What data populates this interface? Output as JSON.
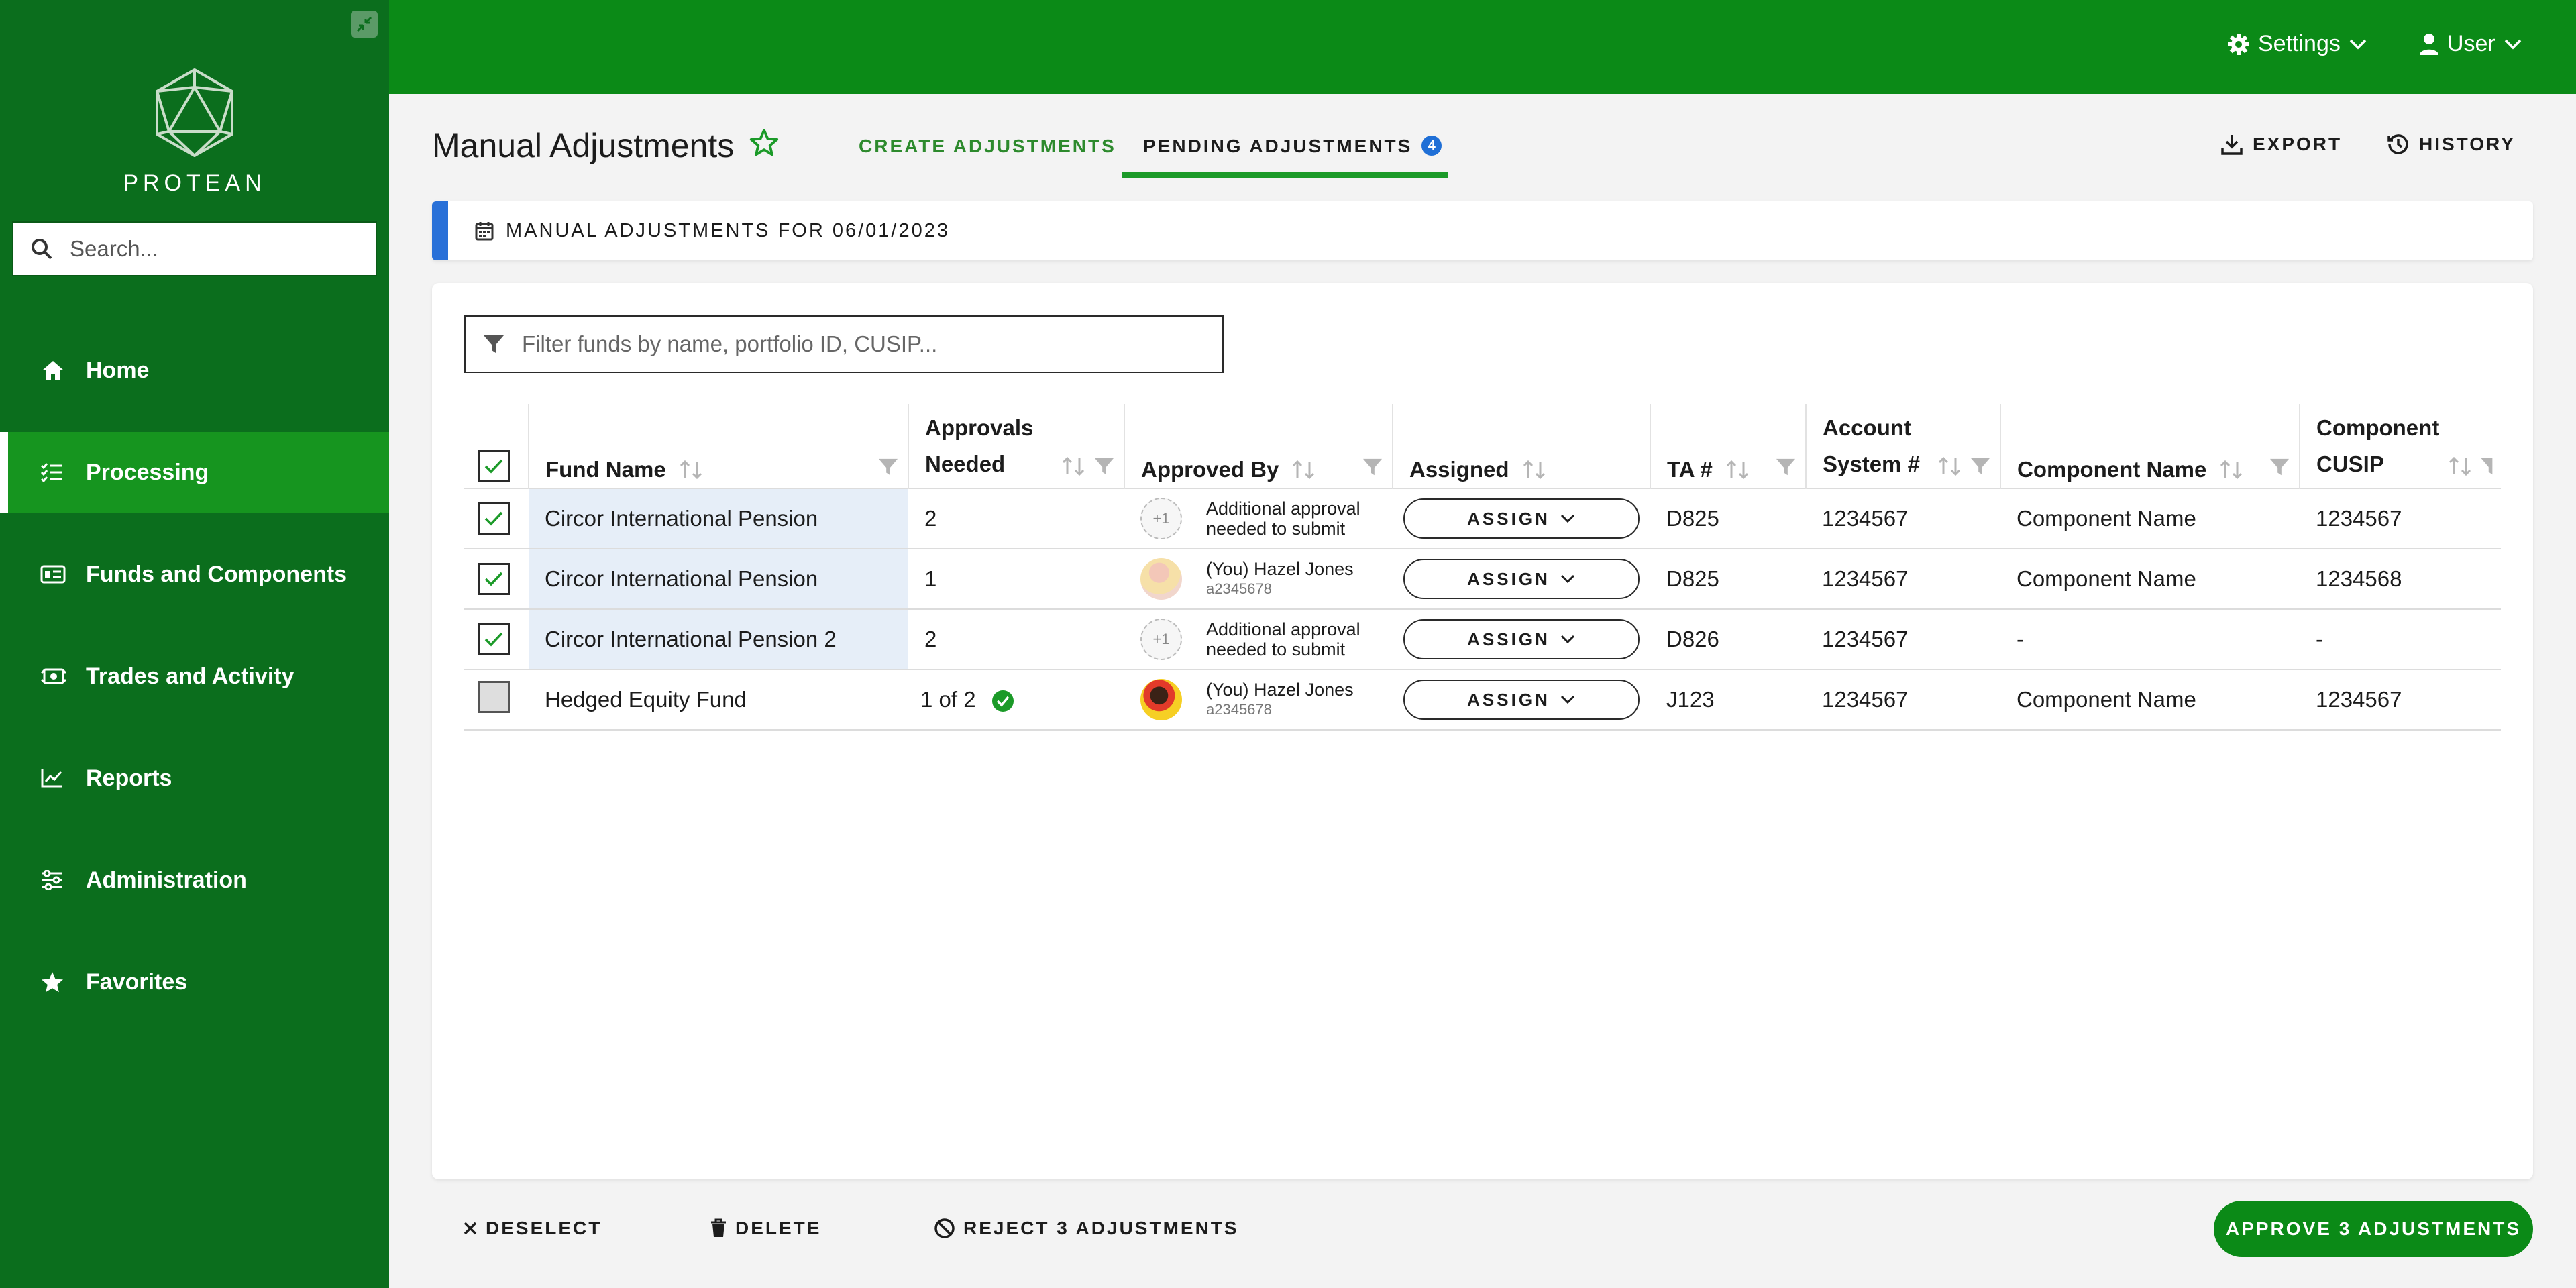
{
  "app": {
    "logo_text": "PROTEAN",
    "search_placeholder": "Search..."
  },
  "sidebar": {
    "items": [
      {
        "label": "Home",
        "icon": "home-icon"
      },
      {
        "label": "Processing",
        "icon": "checklist-icon",
        "active": true
      },
      {
        "label": "Funds and Components",
        "icon": "id-card-icon"
      },
      {
        "label": "Trades and Activity",
        "icon": "money-exchange-icon"
      },
      {
        "label": "Reports",
        "icon": "line-chart-icon"
      },
      {
        "label": "Administration",
        "icon": "sliders-icon"
      },
      {
        "label": "Favorites",
        "icon": "star-icon"
      }
    ]
  },
  "topbar": {
    "settings_label": "Settings",
    "user_label": "User"
  },
  "header": {
    "title": "Manual Adjustments",
    "tabs": [
      {
        "label": "CREATE ADJUSTMENTS"
      },
      {
        "label": "PENDING ADJUSTMENTS",
        "badge": "4",
        "active": true
      }
    ],
    "export_label": "EXPORT",
    "history_label": "HISTORY"
  },
  "banner": {
    "text": "MANUAL ADJUSTMENTS FOR 06/01/2023"
  },
  "table": {
    "filter_placeholder": "Filter funds by name, portfolio ID, CUSIP...",
    "columns": {
      "fund_name": "Fund Name",
      "approvals_line1": "Approvals",
      "approvals_line2": "Needed",
      "approved_by": "Approved By",
      "assigned": "Assigned",
      "ta": "TA #",
      "account_line1": "Account",
      "account_line2": "System  #",
      "component_name": "Component Name",
      "cusip_line1": "Component",
      "cusip_line2": "CUSIP"
    },
    "assign_label": "ASSIGN",
    "rows": [
      {
        "fund": "Circor International Pension",
        "approvals": "2",
        "approver_main": "Additional approval",
        "approver_sub": "needed to submit",
        "avatar_text": "+1",
        "ta": "D825",
        "account": "1234567",
        "component": "Component Name",
        "cusip": "1234567"
      },
      {
        "fund": "Circor International Pension",
        "approvals": "1",
        "approver_main": "(You) Hazel Jones",
        "approver_sub": "a2345678",
        "ta": "D825",
        "account": "1234567",
        "component": "Component Name",
        "cusip": "1234568"
      },
      {
        "fund": "Circor International Pension 2",
        "approvals": "2",
        "approver_main": "Additional approval",
        "approver_sub": "needed to submit",
        "avatar_text": "+1",
        "ta": "D826",
        "account": "1234567",
        "component": "-",
        "cusip": "-"
      },
      {
        "fund": "Hedged Equity Fund",
        "approvals": "1 of 2",
        "approver_main": "(You) Hazel Jones",
        "approver_sub": "a2345678",
        "ta": "J123",
        "account": "1234567",
        "component": "Component Name",
        "cusip": "1234567"
      }
    ]
  },
  "footer": {
    "deselect_label": "DESELECT",
    "delete_label": "DELETE",
    "reject_label": "REJECT 3 ADJUSTMENTS",
    "approve_label": "APPROVE 3 ADJUSTMENTS"
  },
  "colors": {
    "sidebar_bg": "#0b6e1d",
    "topbar_bg": "#0b8a17",
    "active_nav": "#16951f",
    "accent_blue": "#2870d8",
    "tab_underline": "#1b9a28"
  }
}
